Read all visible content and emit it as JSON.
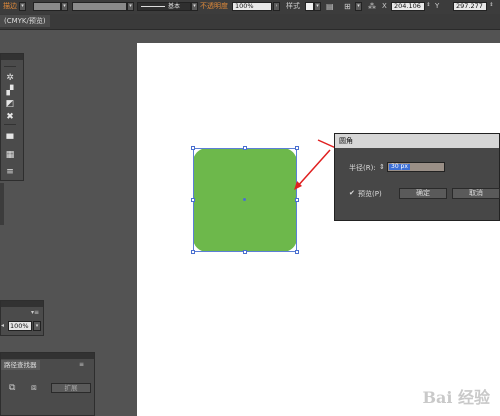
{
  "control_bar": {
    "stroke_label": "描边",
    "brush_label": "基本",
    "opacity_label": "不透明度",
    "opacity_value": "100%",
    "style_label": "样式",
    "x_value": "204.106",
    "y_value": "297.277"
  },
  "document": {
    "tab_label": "(CMYK/预览)"
  },
  "panels": {
    "zoom_value": "100%",
    "pathfinder_title": "路径查找器",
    "expand_label": "扩展"
  },
  "dialog": {
    "title": "圆角",
    "radius_label": "半径(R):",
    "radius_value": "30 px",
    "preview_label": "预览(P)",
    "preview_checked": true,
    "ok_label": "确定",
    "cancel_label": "取消"
  },
  "watermark": {
    "text": "Bai 经验"
  },
  "colors": {
    "shape_fill": "#6db84b",
    "selection": "#4a6fd0",
    "arrow": "#e02020"
  }
}
